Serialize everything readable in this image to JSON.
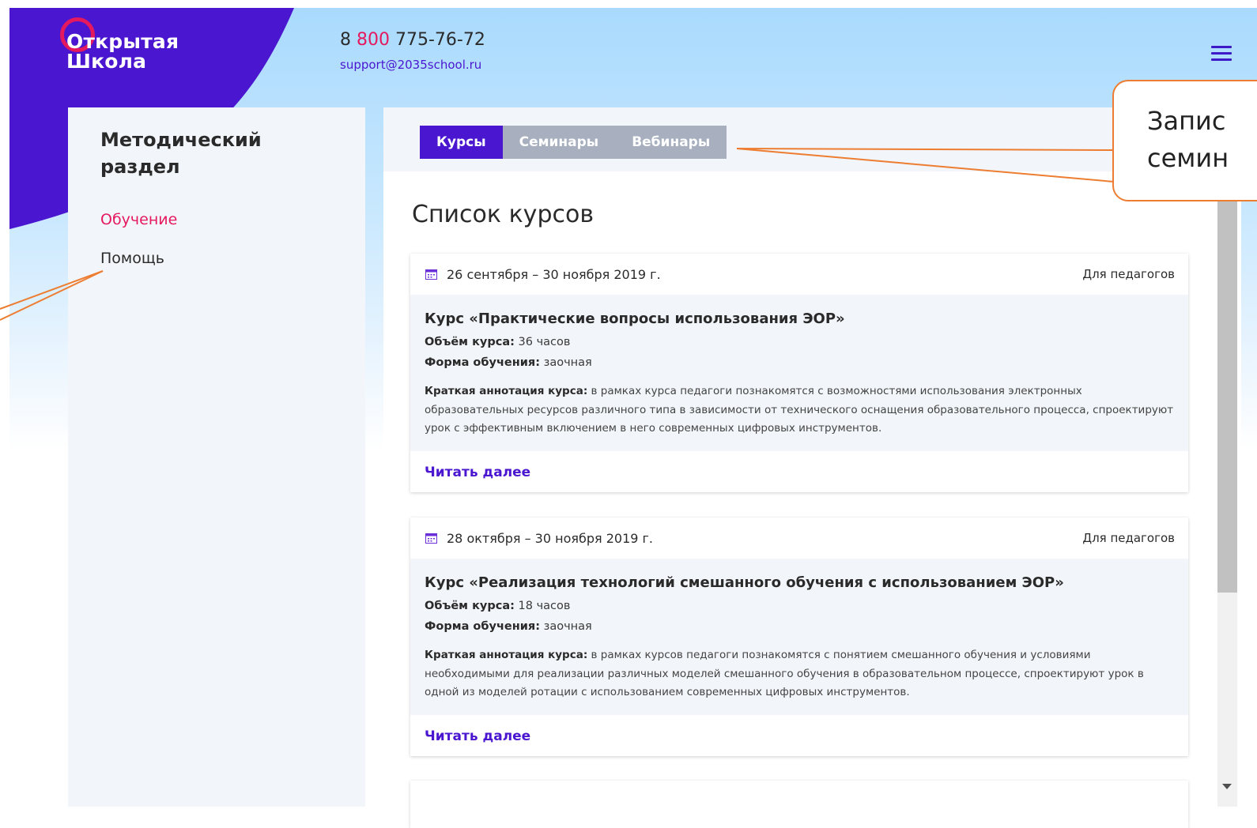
{
  "header": {
    "logo_text": "Открытая Школа",
    "phone_prefix": "8 ",
    "phone_highlight": "800",
    "phone_rest": " 775-76-72",
    "email": "support@2035school.ru"
  },
  "sidebar": {
    "title": "Методический раздел",
    "items": [
      {
        "label": "Обучение",
        "active": true
      },
      {
        "label": "Помощь",
        "active": false
      }
    ]
  },
  "tabs": [
    {
      "label": "Курсы",
      "active": true
    },
    {
      "label": "Семинары",
      "active": false
    },
    {
      "label": "Вебинары",
      "active": false
    }
  ],
  "main": {
    "heading": "Список курсов",
    "courses": [
      {
        "date": "26 сентября – 30 ноября 2019 г.",
        "audience": "Для педагогов",
        "title": "Курс «Практические вопросы использования ЭОР»",
        "volume_label": "Объём курса:",
        "volume_value": " 36 часов",
        "form_label": "Форма обучения:",
        "form_value": " заочная",
        "abstract_label": "Краткая аннотация курса:",
        "abstract_text": " в рамках курса педагоги познакомятся с возможностями использования электронных образовательных ресурсов различного типа в зависимости от технического оснащения образовательного процесса, спроектируют урок с эффективным включением в него современных цифровых инструментов.",
        "read_more": "Читать далее"
      },
      {
        "date": "28 октября – 30 ноября 2019 г.",
        "audience": "Для педагогов",
        "title": "Курс «Реализация технологий смешанного обучения с использованием ЭОР»",
        "volume_label": "Объём курса:",
        "volume_value": " 18 часов",
        "form_label": "Форма обучения:",
        "form_value": " заочная",
        "abstract_label": "Краткая аннотация курса:",
        "abstract_text": " в рамках курсов педагоги познакомятся с понятием смешанного обучения и условиями необходимыми для реализации различных моделей смешанного обучения в образовательном процессе, спроектируют урок в одной из моделей ротации с использованием современных цифровых инструментов.",
        "read_more": "Читать далее"
      }
    ]
  },
  "callout": {
    "line1": "Запис",
    "line2": "семин"
  },
  "colors": {
    "brand_purple": "#4a16d0",
    "accent_pink": "#e5195e",
    "annotation_orange": "#ed7d31"
  },
  "icons": [
    "calendar-icon",
    "hamburger-menu-icon",
    "scroll-down-arrow-icon"
  ]
}
